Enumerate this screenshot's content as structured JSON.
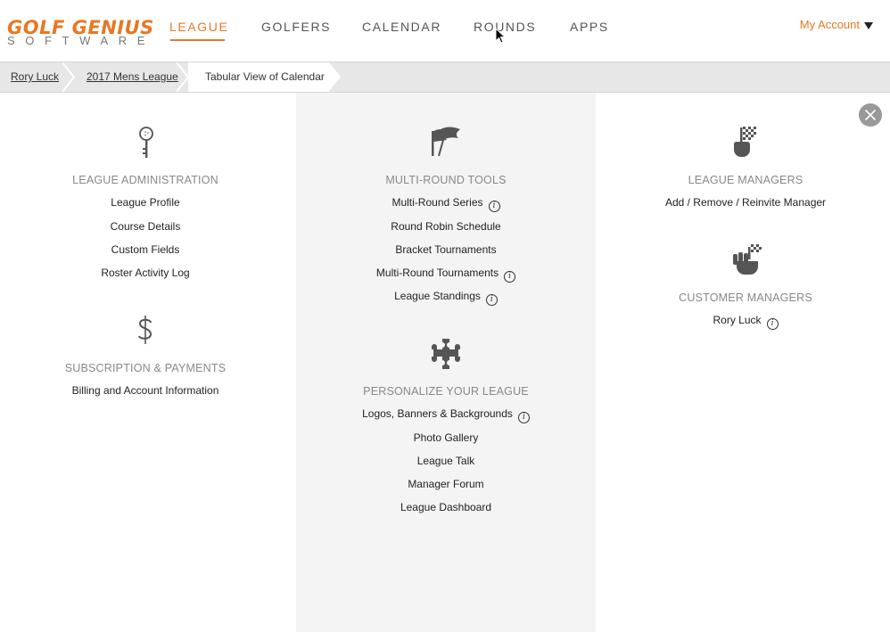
{
  "brand": {
    "logo_top": "GOLF GENIUS",
    "logo_bottom": "SOFTWARE",
    "accent": "#e87722"
  },
  "nav": {
    "items": [
      {
        "label": "LEAGUE"
      },
      {
        "label": "GOLFERS"
      },
      {
        "label": "CALENDAR"
      },
      {
        "label": "ROUNDS"
      },
      {
        "label": "APPS"
      }
    ],
    "active": "LEAGUE",
    "account_label": "My Account"
  },
  "breadcrumb": {
    "items": [
      {
        "label": "Rory Luck"
      },
      {
        "label": "2017 Mens League"
      },
      {
        "label": "Tabular View of Calendar"
      }
    ]
  },
  "sections": {
    "league_admin": {
      "title": "LEAGUE ADMINISTRATION",
      "icon": "key-icon",
      "links": [
        "League Profile",
        "Course Details",
        "Custom Fields",
        "Roster Activity Log"
      ]
    },
    "subscription": {
      "title": "SUBSCRIPTION & PAYMENTS",
      "icon": "dollar-icon",
      "links": [
        "Billing and Account Information"
      ]
    },
    "multi_round": {
      "title": "MULTI-ROUND TOOLS",
      "icon": "flags-icon",
      "links": [
        "Multi-Round Series",
        "Round Robin Schedule",
        "Bracket Tournaments",
        "Multi-Round Tournaments",
        "League Standings"
      ]
    },
    "personalize": {
      "title": "PERSONALIZE YOUR LEAGUE",
      "icon": "puzzle-icon",
      "links": [
        "Logos, Banners & Backgrounds",
        "Photo Gallery",
        "League Talk",
        "Manager Forum",
        "League Dashboard"
      ]
    },
    "league_managers": {
      "title": "LEAGUE MANAGERS",
      "icon": "finger-flag-icon",
      "links": [
        "Add / Remove / Reinvite Manager"
      ]
    },
    "customer_managers": {
      "title": "CUSTOMER MANAGERS",
      "icon": "fist-flag-icon",
      "links": [
        "Rory Luck"
      ]
    }
  }
}
